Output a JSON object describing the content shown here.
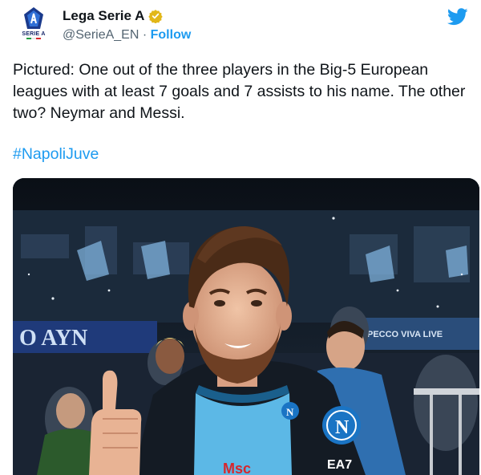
{
  "account": {
    "display_name": "Lega Serie A",
    "handle": "@SerieA_EN",
    "separator": "·",
    "follow_label": "Follow",
    "avatar_text": "SERIE A",
    "verified_icon": "verified-badge-icon",
    "brand_icon": "twitter-bird-icon"
  },
  "tweet": {
    "text": "Pictured: One out of the three players in the Big-5 European leagues with at least 7 goals and 7 assists to his name. The other two? Neymar and Messi.",
    "hashtag": "#NapoliJuve"
  },
  "photo": {
    "banner_left": "O AYN",
    "banner_right": "PECCO VIVA LIVE"
  },
  "colors": {
    "twitter_blue": "#1d9bf0",
    "verified_gold": "#e2b719",
    "text": "#0f1419",
    "secondary": "#536471",
    "napoli_blue": "#5cb8e6"
  }
}
